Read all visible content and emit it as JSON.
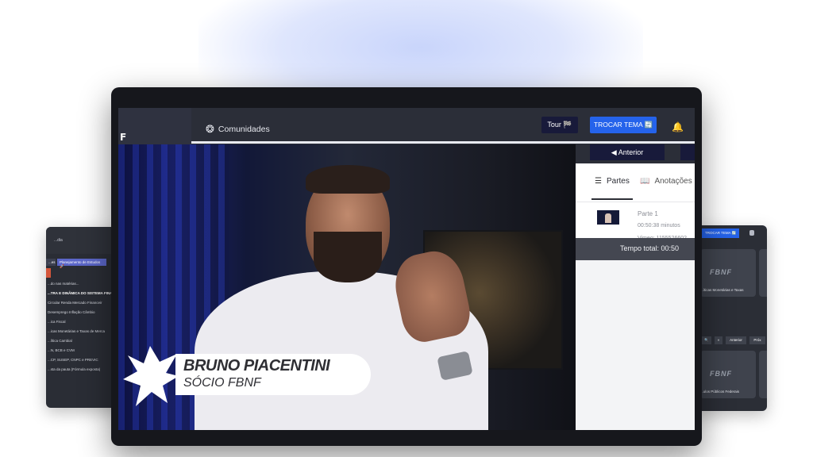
{
  "main": {
    "header": {
      "nav_label": "Comunidades",
      "tour_label": "Tour 🏁",
      "tema_label": "TROCAR TEMA 🔄",
      "icons": {
        "community": "community-icon",
        "bell": "bell-icon"
      }
    },
    "video": {
      "speaker_name": "BRUNO PIACENTINI",
      "speaker_role": "SÓCIO FBNF"
    },
    "sidebar": {
      "prev_label": "Anterior",
      "tabs": [
        {
          "label": "Partes",
          "icon": "list-icon"
        },
        {
          "label": "Anotações",
          "icon": "book-icon"
        }
      ],
      "part": {
        "title": "Parte 1",
        "duration": "00:50:38 minutos",
        "vimeo": "Vimeo: 1155526602"
      },
      "total_label": "Tempo total: 00:50"
    }
  },
  "left_mockup": {
    "top_label": "...dia",
    "chip_a": "...es",
    "chip_b": "Planejamento de Estudos 🚀",
    "items": [
      "...do nas matérias...",
      "...TRA E DINÂMICA DO SISTEMA FINANCEI",
      "Circular Renda Mercado Financeir",
      "Desemprego Inflação Câmbio",
      "...ica Fiscal",
      "...icas Monetárias e Taxas de Merca",
      "...lítica Cambial",
      "...N, BCB e CVM",
      "...CP, SUSEP, CNPC e PREVIC",
      "...sta da pauta (Fórmula exposta)"
    ]
  },
  "right_mockup": {
    "tema_label": "TROCAR TEMA 🔄",
    "card1_logo": "FBNF",
    "card1_caption": "...íticas Monetárias e Taxas",
    "card2_logo": "FBNF",
    "card2_caption": "...ulos Públicos Federais",
    "tools": [
      "🔍",
      "«",
      "Anterior",
      "Próx"
    ]
  }
}
